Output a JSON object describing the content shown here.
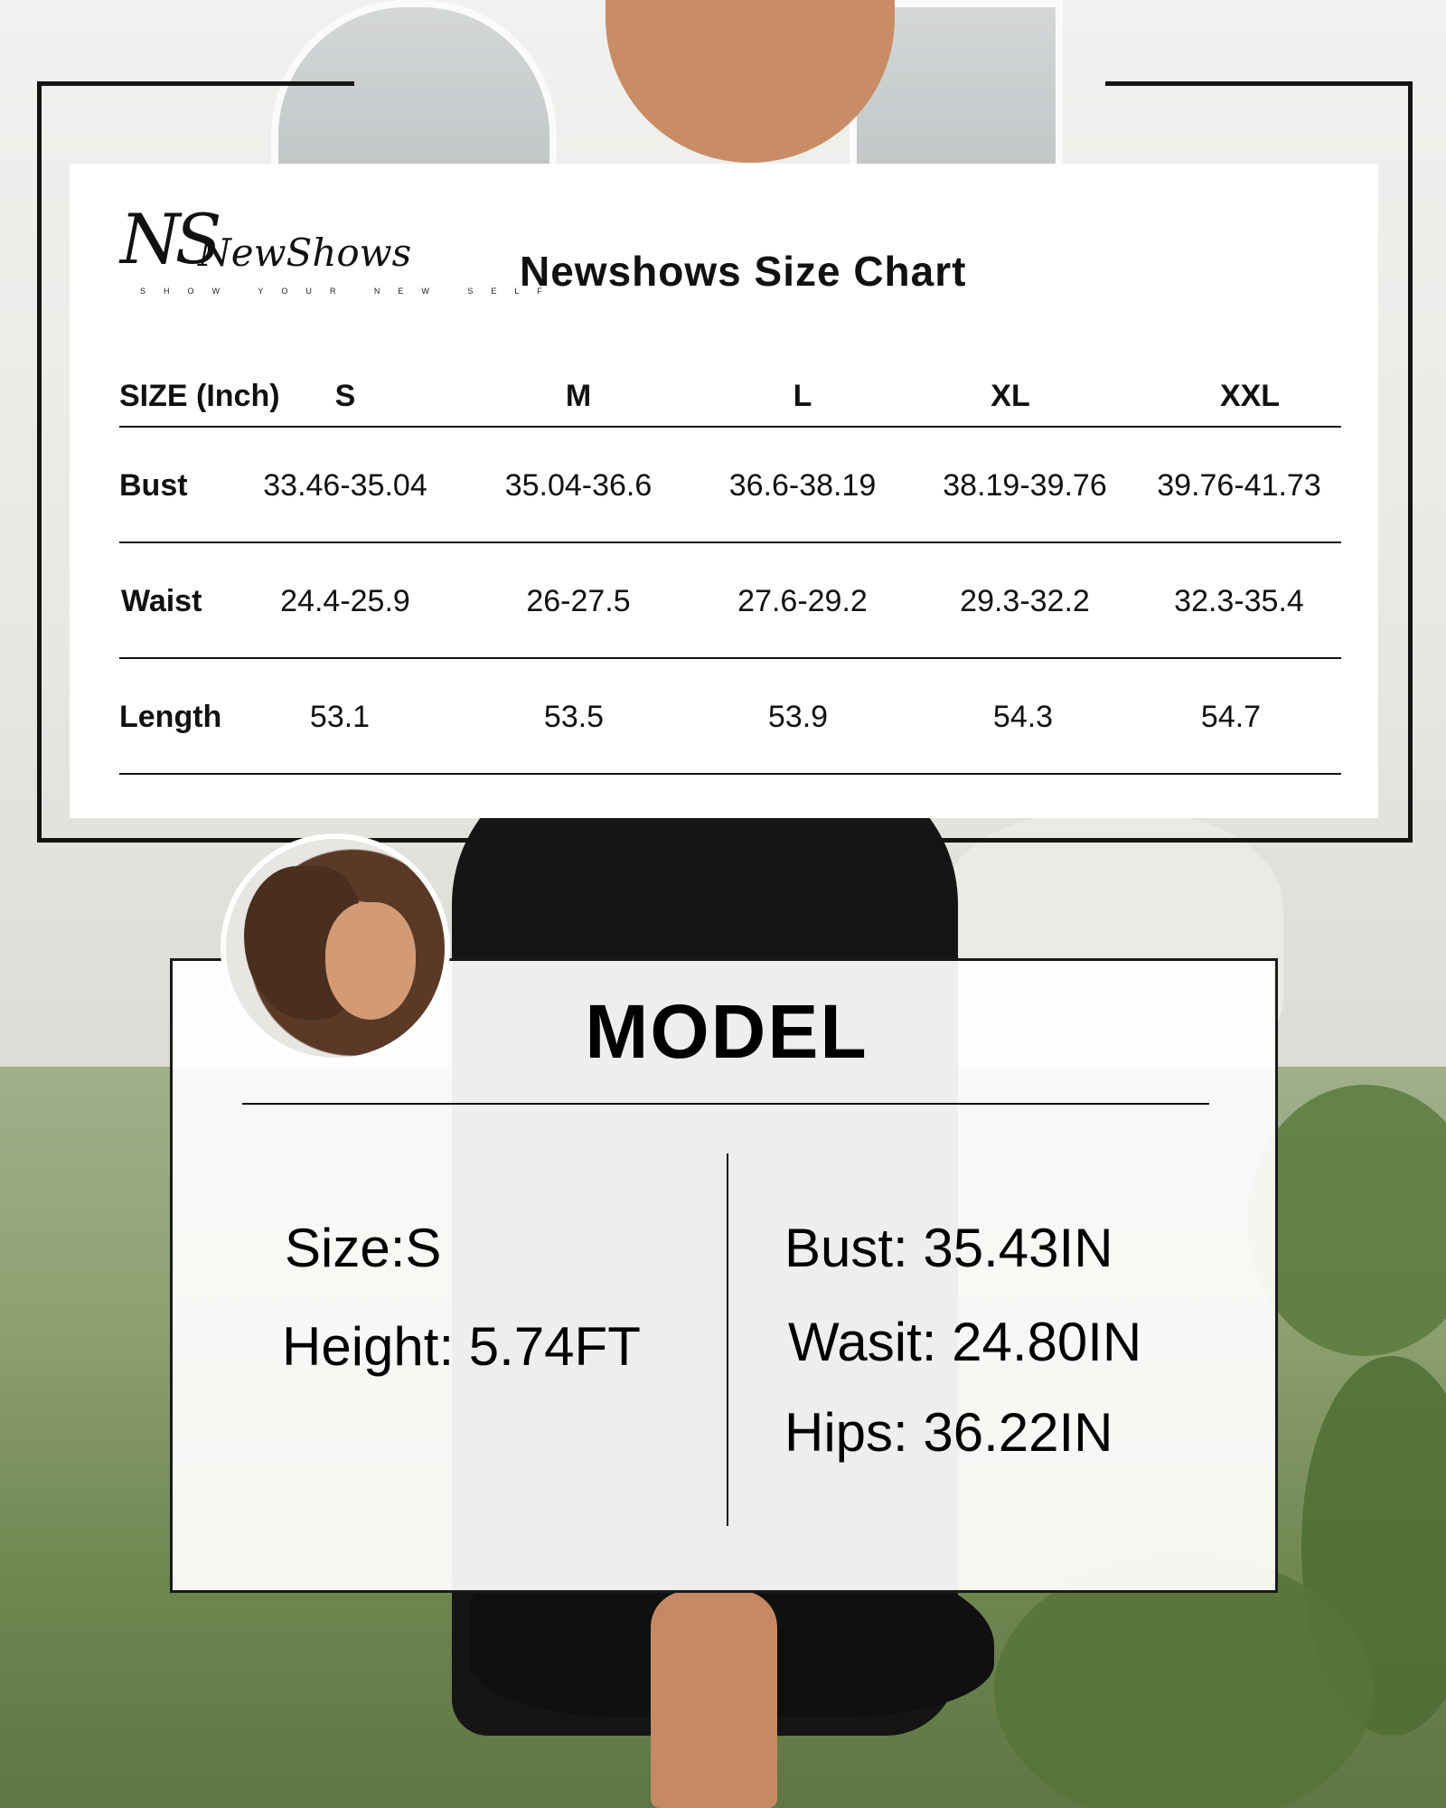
{
  "size_chart": {
    "brand": "NewShows",
    "brand_monogram": "NS",
    "brand_tagline": "SHOW YOUR NEW SELF",
    "title": "Newshows Size Chart",
    "header_label": "SIZE (Inch)",
    "sizes": [
      "S",
      "M",
      "L",
      "XL",
      "XXL"
    ],
    "rows": [
      {
        "label": "Bust",
        "values": [
          "33.46-35.04",
          "35.04-36.6",
          "36.6-38.19",
          "38.19-39.76",
          "39.76-41.73"
        ]
      },
      {
        "label": "Waist",
        "values": [
          "24.4-25.9",
          "26-27.5",
          "27.6-29.2",
          "29.3-32.2",
          "32.3-35.4"
        ]
      },
      {
        "label": "Length",
        "values": [
          "53.1",
          "53.5",
          "53.9",
          "54.3",
          "54.7"
        ]
      }
    ]
  },
  "model": {
    "title": "MODEL",
    "size": "Size:S",
    "height": "Height: 5.74FT",
    "bust": "Bust: 35.43IN",
    "waist": "Wasit: 24.80IN",
    "hips": "Hips: 36.22IN"
  }
}
